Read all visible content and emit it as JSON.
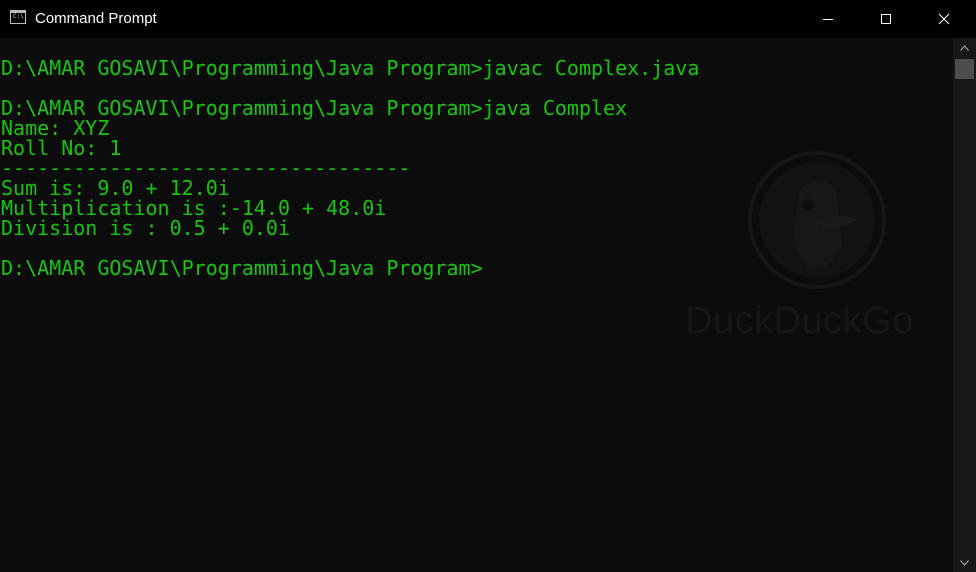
{
  "window": {
    "title": "Command Prompt",
    "icon_name": "cmd-app-icon",
    "icon_glyph": "C:\\",
    "controls": {
      "minimize_icon": "minimize-icon",
      "maximize_icon": "maximize-icon",
      "close_icon": "close-icon"
    }
  },
  "colors": {
    "console_bg": "#0c0c0c",
    "console_text": "#16c60c",
    "titlebar_bg": "#000000",
    "titlebar_text": "#ffffff"
  },
  "console": {
    "lines": [
      "D:\\AMAR GOSAVI\\Programming\\Java Program>javac Complex.java",
      "D:\\AMAR GOSAVI\\Programming\\Java Program>java Complex",
      "Name: XYZ",
      "Roll No: 1",
      "----------------------------------",
      "Sum is: 9.0 + 12.0i",
      "Multiplication is :-14.0 + 48.0i",
      "Division is : 0.5 + 0.0i",
      "D:\\AMAR GOSAVI\\Programming\\Java Program>"
    ]
  },
  "watermark": {
    "text": "DuckDuckGo",
    "icon_name": "duckduckgo-logo-icon"
  },
  "scrollbar": {
    "up_icon": "scroll-up-arrow-icon",
    "down_icon": "scroll-down-arrow-icon"
  }
}
